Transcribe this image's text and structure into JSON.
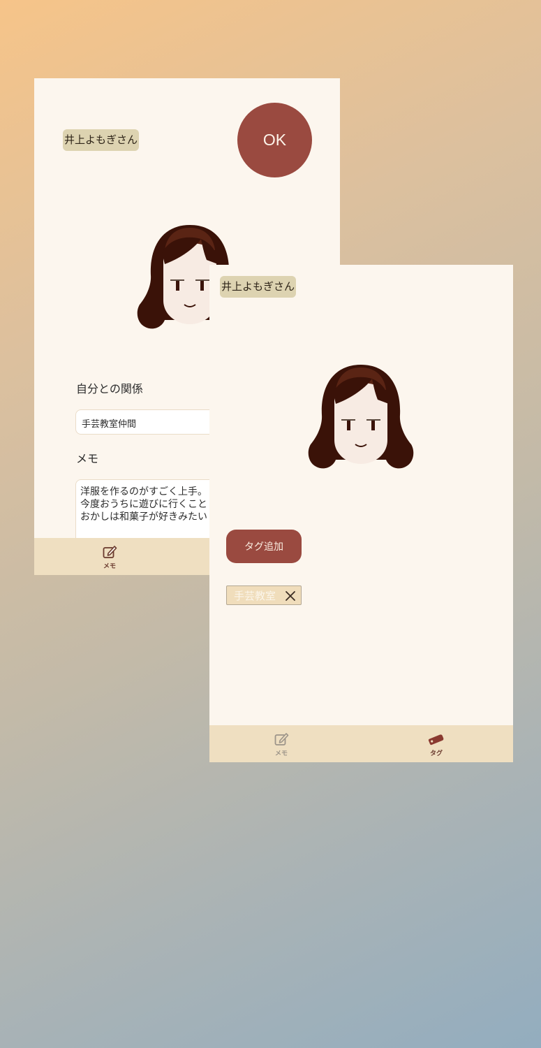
{
  "edit_screen": {
    "name_label": "井上よもぎさん",
    "ok_label": "OK",
    "relation_label": "自分との関係",
    "relation_value": "手芸教室仲間",
    "memo_label": "メモ",
    "memo_lines": [
      "洋服を作るのがすごく上手。",
      "今度おうちに遊びに行くこと",
      "おかしは和菓子が好きみたい"
    ],
    "tabs": [
      {
        "label": "メモ",
        "icon": "memo-pencil-icon",
        "active": true
      }
    ]
  },
  "tag_screen": {
    "name_label": "井上よもぎさん",
    "add_tag_label": "タグ追加",
    "tags": [
      {
        "label": "手芸教室",
        "remove_icon": "close-icon"
      }
    ],
    "tabs": [
      {
        "label": "メモ",
        "icon": "memo-pencil-icon",
        "active": false
      },
      {
        "label": "タグ",
        "icon": "tag-icon",
        "active": true
      }
    ]
  },
  "colors": {
    "accent": "#9a4a40",
    "card_background": "#fcf6ee",
    "tab_bar": "#efdfc1",
    "name_chip": "#ddd3b1",
    "tag_chip": "#f0ddbb"
  }
}
